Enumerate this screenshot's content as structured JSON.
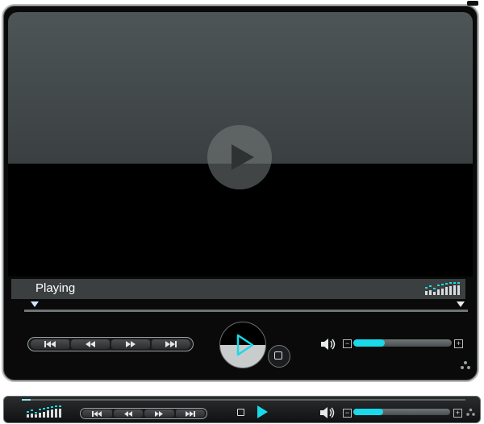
{
  "player": {
    "status": "Playing",
    "colors": {
      "accent": "#19d9ea",
      "screen_top": "#4e5556",
      "frame": "#0a0a0a"
    },
    "icons": {
      "big_play": "play-icon",
      "prev": "skip-previous-icon",
      "rewind": "rewind-icon",
      "forward": "fast-forward-icon",
      "next": "skip-next-icon",
      "play": "play-icon",
      "stop": "stop-icon",
      "volume": "speaker-icon",
      "equalizer": "equalizer-icon",
      "dots": "dots-icon"
    },
    "volume_level": 0.32,
    "seek_position": 0.0
  },
  "mini_player": {
    "volume_level": 0.31,
    "seek_position": 0.02
  }
}
